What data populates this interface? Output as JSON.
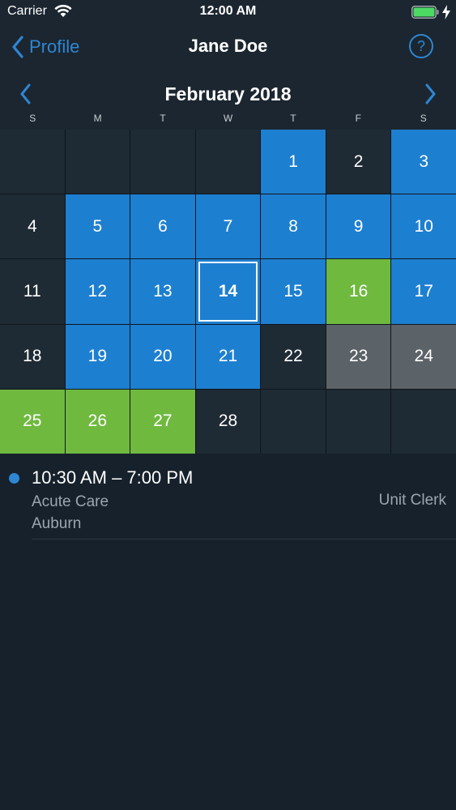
{
  "status_bar": {
    "carrier": "Carrier",
    "time": "12:00 AM",
    "battery_color": "#4cd964"
  },
  "nav": {
    "back_label": "Profile",
    "title": "Jane Doe",
    "help_label": "?"
  },
  "calendar": {
    "month_label": "February 2018",
    "weekdays": [
      "S",
      "M",
      "T",
      "W",
      "T",
      "F",
      "S"
    ],
    "colors": {
      "blue": "#1d7fd0",
      "green": "#6fb93f",
      "gray": "#5b6268",
      "empty": "#1e2a34"
    },
    "cells": [
      {
        "day": "",
        "state": "empty"
      },
      {
        "day": "",
        "state": "empty"
      },
      {
        "day": "",
        "state": "empty"
      },
      {
        "day": "",
        "state": "empty"
      },
      {
        "day": "1",
        "state": "blue"
      },
      {
        "day": "2",
        "state": "empty"
      },
      {
        "day": "3",
        "state": "blue"
      },
      {
        "day": "4",
        "state": "empty"
      },
      {
        "day": "5",
        "state": "blue"
      },
      {
        "day": "6",
        "state": "blue"
      },
      {
        "day": "7",
        "state": "blue"
      },
      {
        "day": "8",
        "state": "blue"
      },
      {
        "day": "9",
        "state": "blue"
      },
      {
        "day": "10",
        "state": "blue"
      },
      {
        "day": "11",
        "state": "empty"
      },
      {
        "day": "12",
        "state": "blue"
      },
      {
        "day": "13",
        "state": "blue"
      },
      {
        "day": "14",
        "state": "today"
      },
      {
        "day": "15",
        "state": "blue"
      },
      {
        "day": "16",
        "state": "green"
      },
      {
        "day": "17",
        "state": "blue"
      },
      {
        "day": "18",
        "state": "empty"
      },
      {
        "day": "19",
        "state": "blue"
      },
      {
        "day": "20",
        "state": "blue"
      },
      {
        "day": "21",
        "state": "blue"
      },
      {
        "day": "22",
        "state": "empty"
      },
      {
        "day": "23",
        "state": "gray"
      },
      {
        "day": "24",
        "state": "gray"
      },
      {
        "day": "25",
        "state": "green"
      },
      {
        "day": "26",
        "state": "green"
      },
      {
        "day": "27",
        "state": "green"
      },
      {
        "day": "28",
        "state": "empty"
      },
      {
        "day": "",
        "state": "empty"
      },
      {
        "day": "",
        "state": "empty"
      },
      {
        "day": "",
        "state": "empty"
      }
    ]
  },
  "events": [
    {
      "time": "10:30 AM – 7:00 PM",
      "department": "Acute Care",
      "location": "Auburn",
      "role": "Unit Clerk"
    }
  ]
}
